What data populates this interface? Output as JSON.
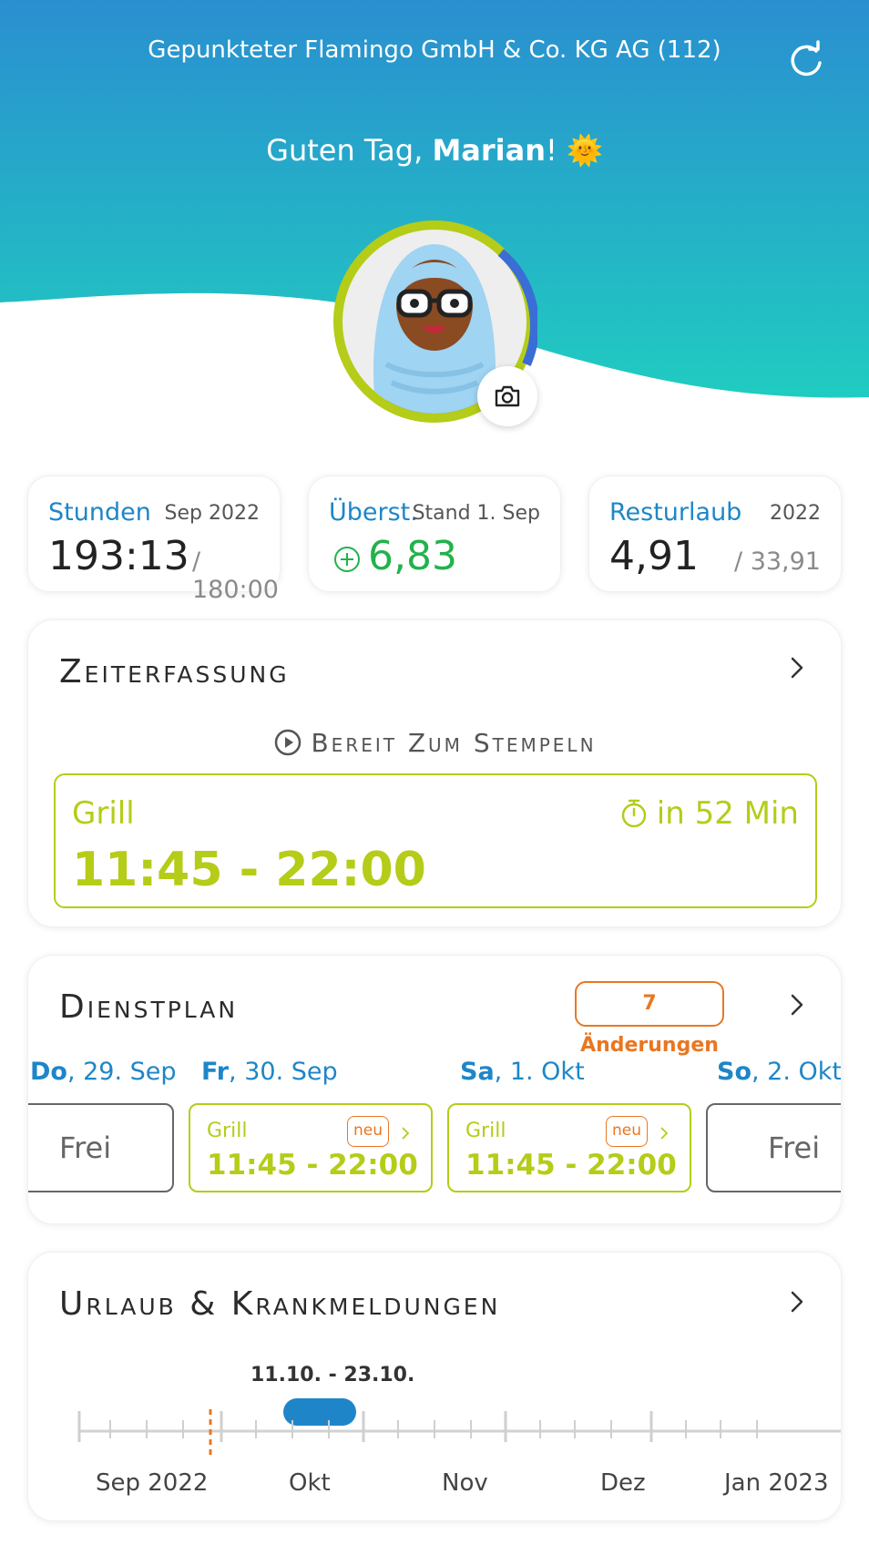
{
  "header": {
    "company": "Gepunkteter Flamingo GmbH & Co. KG AG (112)",
    "greeting_prefix": "Guten Tag, ",
    "user_name": "Marian",
    "greeting_suffix": "!",
    "greeting_emoji": "🌞"
  },
  "stats": {
    "hours": {
      "title": "Stunden",
      "period": "Sep 2022",
      "value": "193:13",
      "target": "/ 180:00"
    },
    "overtime": {
      "title": "Überst.",
      "period": "Stand 1. Sep",
      "value": "6,83"
    },
    "vacation": {
      "title": "Resturlaub",
      "period": "2022",
      "value": "4,91",
      "total": "/ 33,91"
    }
  },
  "time_tracking": {
    "title": "Zeiterfassung",
    "status": "Bereit Zum Stempeln",
    "shift_name": "Grill",
    "shift_time": "11:45 - 22:00",
    "countdown": "in 52 Min"
  },
  "roster": {
    "title": "Dienstplan",
    "changes": "7 Änderungen",
    "days": [
      {
        "weekday": "Do",
        "date": ", 29. Sep",
        "type": "free",
        "label": "Frei"
      },
      {
        "weekday": "Fr",
        "date": ", 30. Sep",
        "type": "shift",
        "name": "Grill",
        "time": "11:45 - 22:00",
        "badge": "neu"
      },
      {
        "weekday": "Sa",
        "date": ", 1. Okt",
        "type": "shift",
        "name": "Grill",
        "time": "11:45 - 22:00",
        "badge": "neu"
      },
      {
        "weekday": "So",
        "date": ", 2. Okt",
        "type": "free",
        "label": "Frei"
      }
    ]
  },
  "absences": {
    "title": "Urlaub & Krankmeldungen",
    "range": "11.10. - 23.10.",
    "months": [
      "Sep 2022",
      "Okt",
      "Nov",
      "Dez",
      "Jan 2023"
    ]
  },
  "colors": {
    "header_top": "#2a8fd0",
    "header_bottom": "#20ccc0",
    "accent_blue": "#1e86c8",
    "accent_green": "#b5cc18",
    "overtime_green": "#22b24c",
    "accent_orange": "#e87722"
  }
}
